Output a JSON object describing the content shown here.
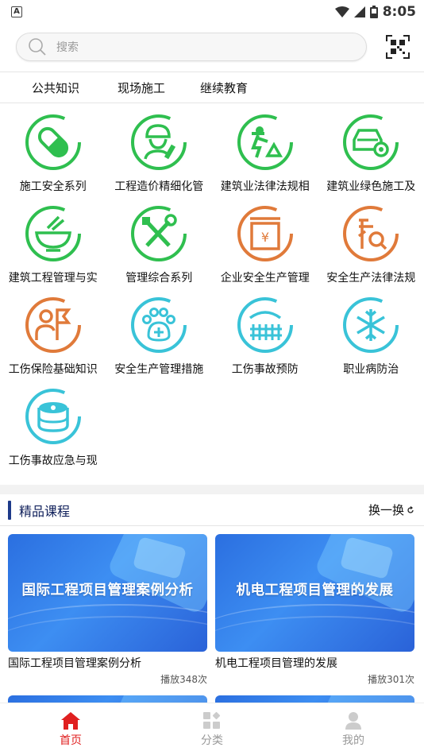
{
  "status_bar": {
    "time": "8:05",
    "left_badge": "A"
  },
  "search": {
    "placeholder": "搜索"
  },
  "tabs": [
    {
      "label": "公共知识"
    },
    {
      "label": "现场施工"
    },
    {
      "label": "继续教育"
    }
  ],
  "categories": [
    {
      "label": "施工安全系列",
      "icon": "pill-icon",
      "color": "#2fbf4f"
    },
    {
      "label": "工程造价精细化管",
      "icon": "worker-icon",
      "color": "#2fbf4f"
    },
    {
      "label": "建筑业法律法规相",
      "icon": "construction-icon",
      "color": "#2fbf4f"
    },
    {
      "label": "建筑业绿色施工及",
      "icon": "car-gear-icon",
      "color": "#2fbf4f"
    },
    {
      "label": "建筑工程管理与实",
      "icon": "bowl-icon",
      "color": "#2fbf4f"
    },
    {
      "label": "管理综合系列",
      "icon": "tools-icon",
      "color": "#2fbf4f"
    },
    {
      "label": "企业安全生产管理",
      "icon": "money-box-icon",
      "color": "#e07a3a"
    },
    {
      "label": "安全生产法律法规",
      "icon": "document-search-icon",
      "color": "#e07a3a"
    },
    {
      "label": "工伤保险基础知识",
      "icon": "person-flag-icon",
      "color": "#e07a3a"
    },
    {
      "label": "安全生产管理措施",
      "icon": "paw-plus-icon",
      "color": "#39c3d8"
    },
    {
      "label": "工伤事故预防",
      "icon": "fence-icon",
      "color": "#39c3d8"
    },
    {
      "label": "职业病防治",
      "icon": "snowflake-icon",
      "color": "#39c3d8"
    },
    {
      "label": "工伤事故应急与现",
      "icon": "database-gear-icon",
      "color": "#39c3d8"
    }
  ],
  "featured": {
    "title": "精品课程",
    "refresh_label": "换一换",
    "courses": [
      {
        "thumb_title": "国际工程项目管理案例分析",
        "name": "国际工程项目管理案例分析",
        "plays": "播放348次"
      },
      {
        "thumb_title": "机电工程项目管理的发展",
        "name": "机电工程项目管理的发展",
        "plays": "播放301次"
      }
    ]
  },
  "bottom_nav": [
    {
      "label": "首页",
      "icon": "home-icon",
      "active": true
    },
    {
      "label": "分类",
      "icon": "category-icon",
      "active": false
    },
    {
      "label": "我的",
      "icon": "profile-icon",
      "active": false
    }
  ],
  "colors": {
    "accent_red": "#e02020",
    "section_bar": "#1e3a8a",
    "green": "#2fbf4f",
    "orange": "#e07a3a",
    "cyan": "#39c3d8"
  }
}
